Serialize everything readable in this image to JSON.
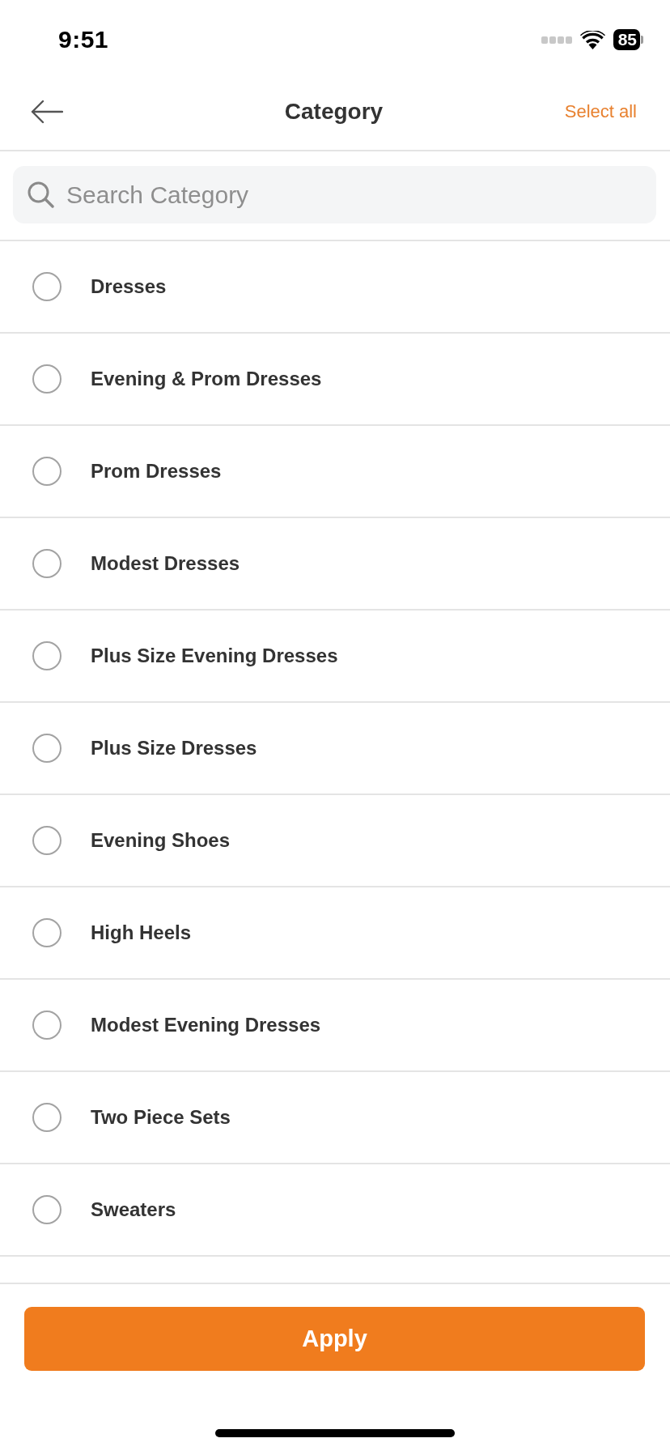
{
  "status_bar": {
    "time": "9:51",
    "battery": "85"
  },
  "header": {
    "title": "Category",
    "action": "Select all"
  },
  "search": {
    "placeholder": "Search Category"
  },
  "categories": [
    {
      "label": "Dresses",
      "selected": false
    },
    {
      "label": "Evening & Prom Dresses",
      "selected": false
    },
    {
      "label": "Prom Dresses",
      "selected": false
    },
    {
      "label": "Modest Dresses",
      "selected": false
    },
    {
      "label": "Plus Size Evening Dresses",
      "selected": false
    },
    {
      "label": "Plus Size Dresses",
      "selected": false
    },
    {
      "label": "Evening Shoes",
      "selected": false
    },
    {
      "label": "High Heels",
      "selected": false
    },
    {
      "label": "Modest Evening Dresses",
      "selected": false
    },
    {
      "label": "Two Piece Sets",
      "selected": false
    },
    {
      "label": "Sweaters",
      "selected": false
    }
  ],
  "apply_button": {
    "label": "Apply"
  }
}
